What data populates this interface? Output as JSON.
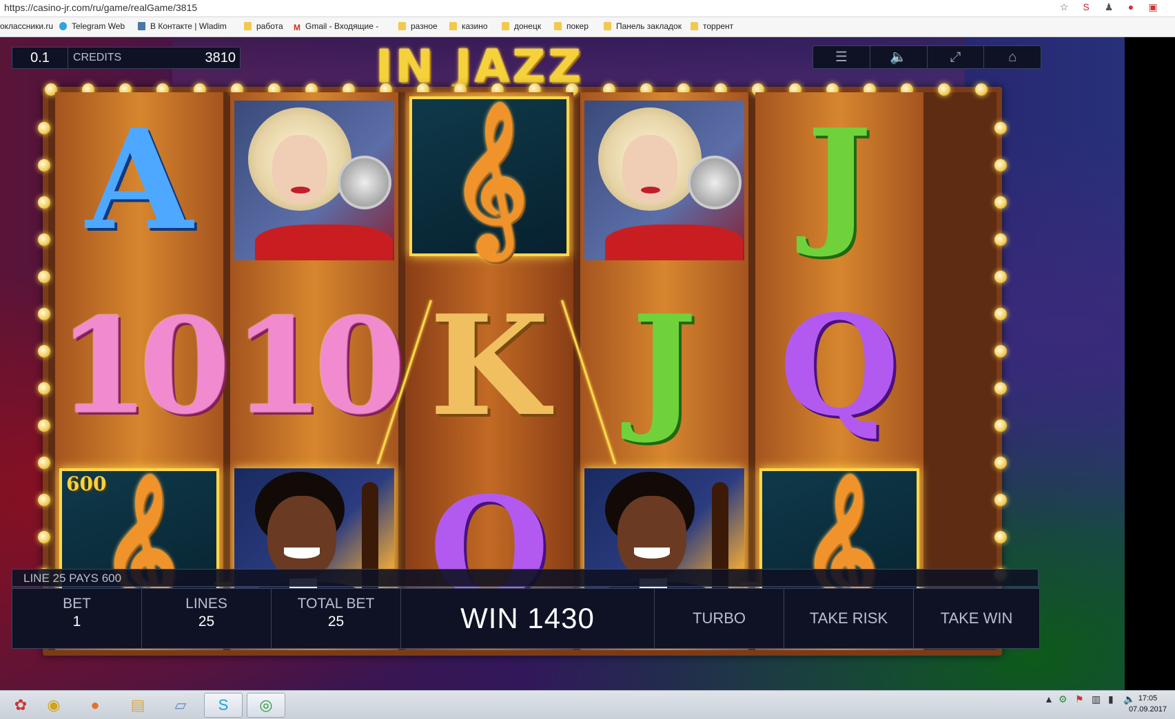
{
  "browser": {
    "url": "https://casino-jr.com/ru/game/realGame/3815",
    "bookmarks": [
      "оклассники.ru",
      "Telegram Web",
      "В Контакте | Wladim",
      "работа",
      "Gmail - Входящие -",
      "разное",
      "казино",
      "донецк",
      "покер",
      "Панель закладок",
      "торрент"
    ]
  },
  "game": {
    "title": "IN JAZZ",
    "denomination": "0.1",
    "credits_label": "CREDITS",
    "credits_value": "3810",
    "top_buttons": [
      "menu-icon",
      "sound-icon",
      "fullscreen-icon",
      "home-icon"
    ],
    "reels": [
      [
        "A",
        "10",
        "clef"
      ],
      [
        "singer",
        "10",
        "bassist"
      ],
      [
        "clef",
        "K",
        "Q"
      ],
      [
        "singer",
        "J",
        "bassist"
      ],
      [
        "J",
        "Q",
        "clef"
      ]
    ],
    "winning_cells": [
      [
        0,
        2
      ],
      [
        1,
        2
      ],
      [
        2,
        0
      ],
      [
        3,
        2
      ],
      [
        4,
        2
      ]
    ],
    "win_badge": "600",
    "pays_line": "LINE 25 PAYS 600",
    "bet_label": "BET",
    "bet_value": "1",
    "lines_label": "LINES",
    "lines_value": "25",
    "total_bet_label": "TOTAL BET",
    "total_bet_value": "25",
    "win_label": "WIN 1430",
    "turbo_label": "TURBO",
    "take_risk_label": "TAKE RISK",
    "take_win_label": "TAKE WIN"
  },
  "taskbar": {
    "apps": [
      "start",
      "webcam",
      "firefox",
      "explorer",
      "notepad",
      "skype",
      "chrome"
    ],
    "time": "17:05",
    "date": "07.09.2017"
  },
  "colors": {
    "gold": "#ffd84a",
    "panel": "#0e1224",
    "accent": "#f6d23a"
  }
}
